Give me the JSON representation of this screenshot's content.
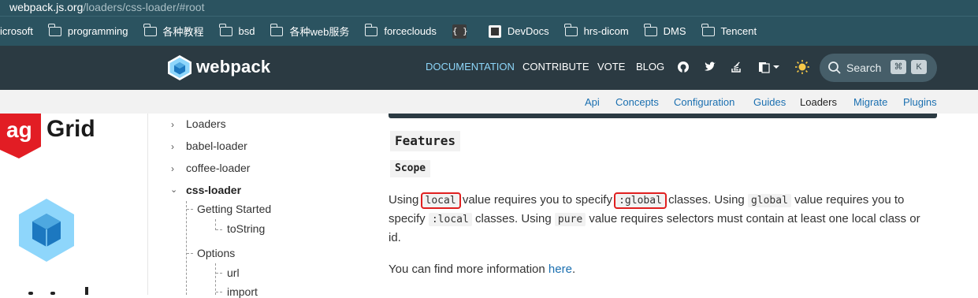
{
  "url": {
    "host": "webpack.js.org",
    "path": "/loaders/css-loader/#root"
  },
  "bookmarks": [
    {
      "label": "icrosoft",
      "icon": "none"
    },
    {
      "label": "programming",
      "icon": "folder-icon"
    },
    {
      "label": "各种教程",
      "icon": "folder-icon"
    },
    {
      "label": "bsd",
      "icon": "folder-icon"
    },
    {
      "label": "各种web服务",
      "icon": "folder-icon"
    },
    {
      "label": "forceclouds",
      "icon": "folder-icon"
    },
    {
      "label": "",
      "icon": "braces-icon",
      "glyph": "{ }"
    },
    {
      "label": "DevDocs",
      "icon": "devdocs-icon"
    },
    {
      "label": "hrs-dicom",
      "icon": "folder-icon"
    },
    {
      "label": "DMS",
      "icon": "folder-icon"
    },
    {
      "label": "Tencent",
      "icon": "folder-icon"
    }
  ],
  "header": {
    "logo_text": "webpack",
    "nav": [
      "DOCUMENTATION",
      "CONTRIBUTE",
      "VOTE",
      "BLOG"
    ],
    "icons": [
      "github-icon",
      "twitter-icon",
      "stackoverflow-icon",
      "language-icon",
      "theme-sun-icon",
      "search-icon"
    ],
    "search": {
      "label": "Search",
      "key1": "⌘",
      "key2": "K"
    },
    "colors": {
      "bg": "#2b3a42",
      "active": "#8dd6f9"
    }
  },
  "subnav": [
    "Api",
    "Concepts",
    "Configuration",
    "Guides",
    "Loaders",
    "Migrate",
    "Plugins"
  ],
  "subnav_current": "Loaders",
  "ad": {
    "brand": "ag-Grid",
    "brand_part1": "ag",
    "brand_part2": "Grid"
  },
  "sidebar": {
    "loaders": "Loaders",
    "babel": "babel-loader",
    "coffee": "coffee-loader",
    "css": "css-loader",
    "getting_started": "Getting Started",
    "tostring": "toString",
    "options": "Options",
    "url": "url",
    "import": "import"
  },
  "content": {
    "features": "Features",
    "scope": "Scope",
    "p1_a": "Using ",
    "code_local": "local",
    "p1_b": " value requires you to specify ",
    "code_global_colon": ":global",
    "p1_c": " classes. Using ",
    "code_global": "global",
    "p1_d": " value requires you to",
    "p2_a": "specify ",
    "code_local_colon": ":local",
    "p2_b": " classes. Using ",
    "code_pure": "pure",
    "p2_c": " value requires selectors must contain at least one local class or",
    "p3": "id.",
    "p4_a": "You can find more information ",
    "p4_link": "here",
    "p4_b": "."
  }
}
